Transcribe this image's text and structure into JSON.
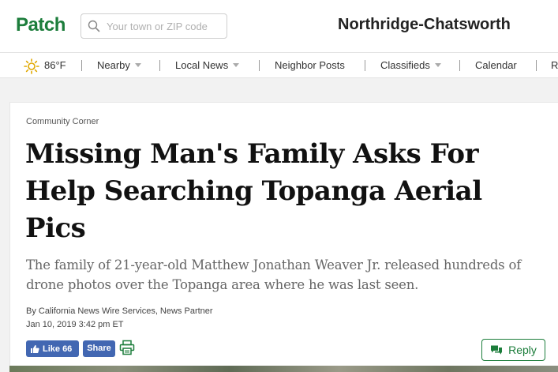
{
  "brand": {
    "logo_text": "Patch",
    "color": "#1c7d3b"
  },
  "search": {
    "placeholder": "Your town or ZIP code"
  },
  "header": {
    "town_name": "Northridge-Chatsworth"
  },
  "nav": {
    "weather": "86°F",
    "weather_icon": "sun-icon",
    "items": [
      {
        "label": "Nearby",
        "has_dropdown": true
      },
      {
        "label": "Local News",
        "has_dropdown": true
      },
      {
        "label": "Neighbor Posts",
        "has_dropdown": false
      },
      {
        "label": "Classifieds",
        "has_dropdown": true
      },
      {
        "label": "Calendar",
        "has_dropdown": false
      },
      {
        "label": "R",
        "has_dropdown": false
      }
    ]
  },
  "article": {
    "category": "Community Corner",
    "headline": "Missing Man's Family Asks For Help Searching Topanga Aerial Pics",
    "dek": "The family of 21-year-old Matthew Jonathan Weaver Jr. released hundreds of drone photos over the Topanga area where he was last seen.",
    "byline": "By California News Wire Services, News Partner",
    "timestamp": "Jan 10, 2019 3:42 pm ET"
  },
  "actions": {
    "like_label": "Like 66",
    "share_label": "Share",
    "print_icon": "print-icon",
    "reply_label": "Reply",
    "facebook_color": "#4267b2"
  }
}
